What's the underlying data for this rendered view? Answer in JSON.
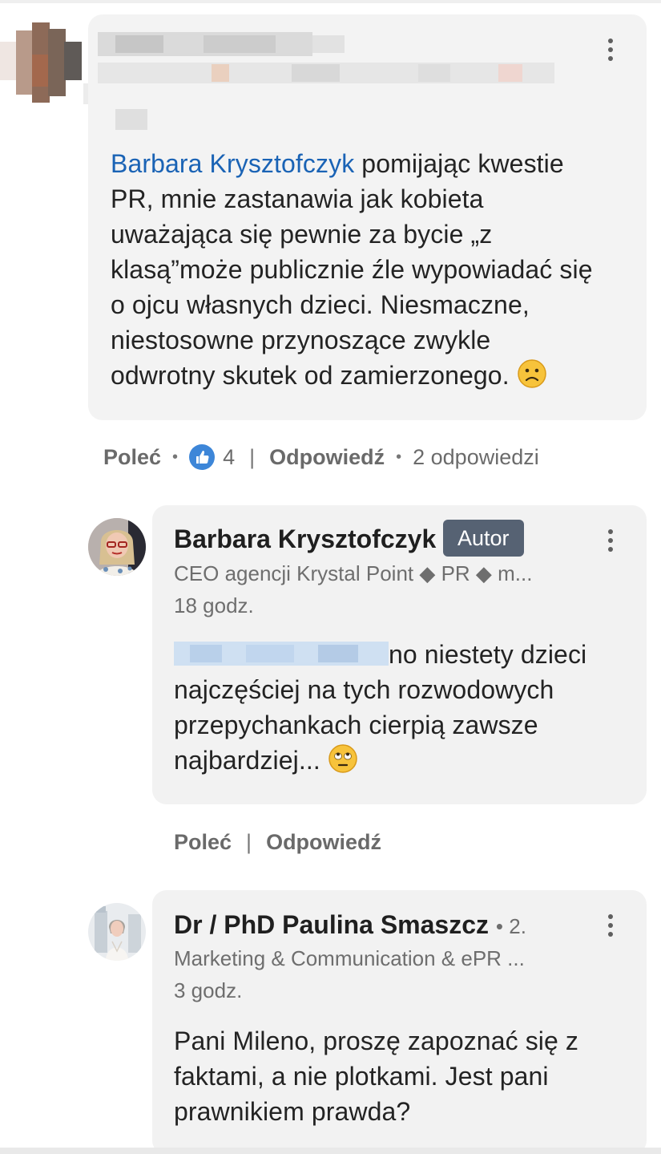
{
  "comment_top": {
    "mention": "Barbara Krysztofczyk",
    "text_lines": [
      " pomijając kwestie",
      "PR, mnie zastanawia jak kobieta",
      "uważająca się pewnie za bycie „z",
      "klasą”może publicznie źle wypowiadać się",
      "o ojcu własnych dzieci. Niesmaczne,",
      "niestosowne przynoszące zwykle",
      "odwrotny skutek od zamierzonego."
    ],
    "emoji": "frowning-face-emoji",
    "actions": {
      "recommend": "Poleć",
      "likes": "4",
      "reply": "Odpowiedź",
      "replies_count": "2 odpowiedzi"
    }
  },
  "reply_1": {
    "name": "Barbara Krysztofczyk",
    "badge": "Autor",
    "headline": "CEO agencji Krystal Point ◆ PR ◆ m...",
    "time": "18 godz.",
    "text_lines": [
      "no niestety dzieci",
      "najczęściej na tych rozwodowych",
      "przepychankach cierpią zawsze",
      "najbardziej..."
    ],
    "emoji": "eye-roll-emoji",
    "actions": {
      "recommend": "Poleć",
      "reply": "Odpowiedź"
    }
  },
  "reply_2": {
    "name": "Dr / PhD Paulina Smaszcz",
    "degree": "• 2.",
    "headline": "Marketing & Communication & ePR ...",
    "time": "3 godz.",
    "text_lines": [
      "Pani Mileno, proszę zapoznać się z",
      "faktami, a nie plotkami. Jest pani",
      "prawnikiem prawda?"
    ]
  },
  "colors": {
    "mention": "#1a63b5",
    "bubble": "#f2f2f2",
    "badge": "#566273",
    "like": "#3d86d8"
  }
}
